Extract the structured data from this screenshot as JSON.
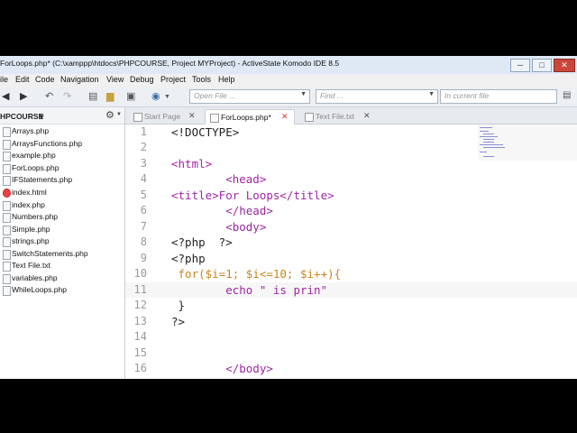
{
  "window": {
    "title": "ForLoops.php* (C:\\xamppp\\htdocs\\PHPCOURSE, Project MYProject) - ActiveState Komodo IDE 8.5",
    "buttons": {
      "minimize": "─",
      "maximize": "□",
      "close": "✕"
    }
  },
  "menu": [
    "ile",
    "Edit",
    "Code",
    "Navigation",
    "View",
    "Debug",
    "Project",
    "Tools",
    "Help"
  ],
  "toolbar": {
    "open_file_placeholder": "Open File ...",
    "find_placeholder": "Find ...",
    "scope_placeholder": "In current file"
  },
  "sidebar": {
    "project_label": "HPCOURSE",
    "files": [
      {
        "name": "Arrays.php",
        "type": "php"
      },
      {
        "name": "ArraysFunctions.php",
        "type": "php"
      },
      {
        "name": "example.php",
        "type": "php"
      },
      {
        "name": "ForLoops.php",
        "type": "php"
      },
      {
        "name": "IFStatements.php",
        "type": "php"
      },
      {
        "name": "index.html",
        "type": "html"
      },
      {
        "name": "index.php",
        "type": "php"
      },
      {
        "name": "Numbers.php",
        "type": "php"
      },
      {
        "name": "Simple.php",
        "type": "php"
      },
      {
        "name": "strings.php",
        "type": "php"
      },
      {
        "name": "SwitchStatements.php",
        "type": "php"
      },
      {
        "name": "Text File.txt",
        "type": "txt"
      },
      {
        "name": "variables.php",
        "type": "php"
      },
      {
        "name": "WhileLoops.php",
        "type": "php"
      }
    ]
  },
  "tabs": [
    {
      "label": "Start Page",
      "active": false
    },
    {
      "label": "ForLoops.php*",
      "active": true
    },
    {
      "label": "Text File.txt",
      "active": false
    }
  ],
  "editor": {
    "lines": [
      {
        "n": "1",
        "text": "<!DOCTYPE>"
      },
      {
        "n": "2",
        "text": ""
      },
      {
        "n": "3",
        "text": "<html>"
      },
      {
        "n": "4",
        "text": "        <head>"
      },
      {
        "n": "5",
        "text": "<title>For Loops</title>"
      },
      {
        "n": "6",
        "text": "        </head>"
      },
      {
        "n": "7",
        "text": "        <body>"
      },
      {
        "n": "8",
        "text": "<?php  ?>"
      },
      {
        "n": "9",
        "text": "<?php"
      },
      {
        "n": "10",
        "text": " for($i=1; $i<=10; $i++){"
      },
      {
        "n": "11",
        "text": "        echo \" is prin\""
      },
      {
        "n": "12",
        "text": " }"
      },
      {
        "n": "13",
        "text": "?>"
      },
      {
        "n": "14",
        "text": ""
      },
      {
        "n": "15",
        "text": ""
      },
      {
        "n": "16",
        "text": "        </body>"
      }
    ],
    "current_line": 11
  },
  "colors": {
    "keyword": "#9f25a5",
    "variable": "#c8841f",
    "line_number": "#999999",
    "titlebar": "#dfe9f5"
  }
}
